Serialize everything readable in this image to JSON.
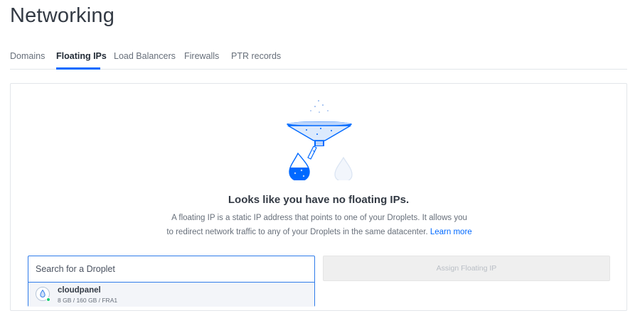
{
  "header": {
    "title": "Networking"
  },
  "tabs": [
    {
      "label": "Domains",
      "active": false
    },
    {
      "label": "Floating IPs",
      "active": true
    },
    {
      "label": "Load Balancers",
      "active": false
    },
    {
      "label": "Firewalls",
      "active": false
    },
    {
      "label": "PTR records",
      "active": false
    }
  ],
  "empty_state": {
    "heading": "Looks like you have no floating IPs.",
    "description_line1": "A floating IP is a static IP address that points to one of your Droplets. It allows you",
    "description_line2": "to redirect network traffic to any of your Droplets in the same datacenter.",
    "learn_more": "Learn more",
    "illustration_icon": "funnel-droplet-illustration"
  },
  "search": {
    "placeholder": "Search for a Droplet",
    "value": ""
  },
  "droplet_results": [
    {
      "name": "cloudpanel",
      "meta": "8 GB / 160 GB / FRA1",
      "status": "active",
      "icon": "droplet-icon"
    }
  ],
  "assign_button": {
    "label": "Assign Floating IP",
    "enabled": false
  },
  "colors": {
    "accent": "#0069ff",
    "status_active": "#15cd72",
    "disabled_bg": "#efefef"
  }
}
